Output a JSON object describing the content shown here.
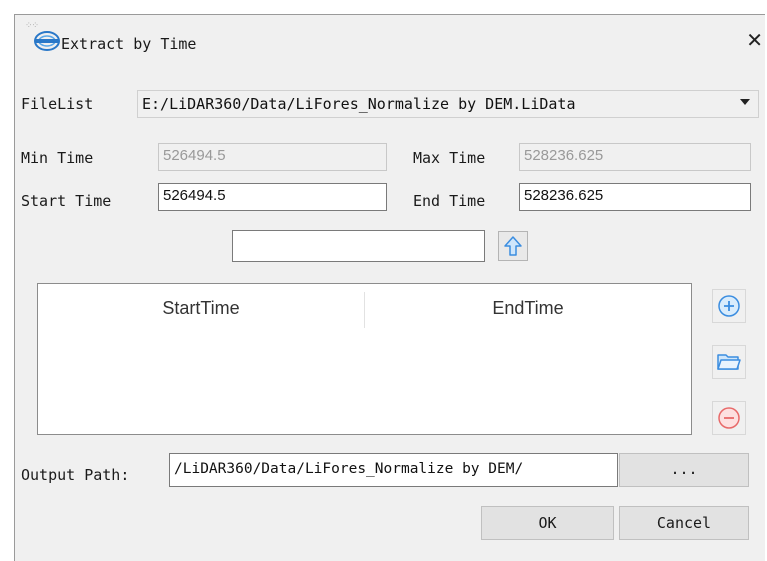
{
  "window": {
    "title": "Extract by Time"
  },
  "filelist": {
    "label": "FileList",
    "value": "E:/LiDAR360/Data/LiFores_Normalize by DEM.LiData"
  },
  "min_time": {
    "label": "Min Time",
    "value": "526494.5"
  },
  "max_time": {
    "label": "Max Time",
    "value": "528236.625"
  },
  "start_time": {
    "label": "Start Time",
    "value": "526494.5"
  },
  "end_time": {
    "label": "End Time",
    "value": "528236.625"
  },
  "time_input": {
    "value": ""
  },
  "table": {
    "columns": [
      "StartTime",
      "EndTime"
    ],
    "rows": []
  },
  "output": {
    "label": "Output Path:",
    "value": "/LiDAR360/Data/LiFores_Normalize by DEM/",
    "browse_label": "..."
  },
  "buttons": {
    "ok": "OK",
    "cancel": "Cancel"
  },
  "colors": {
    "icon_blue": "#3b8de0",
    "icon_red": "#e86a6a",
    "dialog_bg": "#f0f0f0"
  }
}
